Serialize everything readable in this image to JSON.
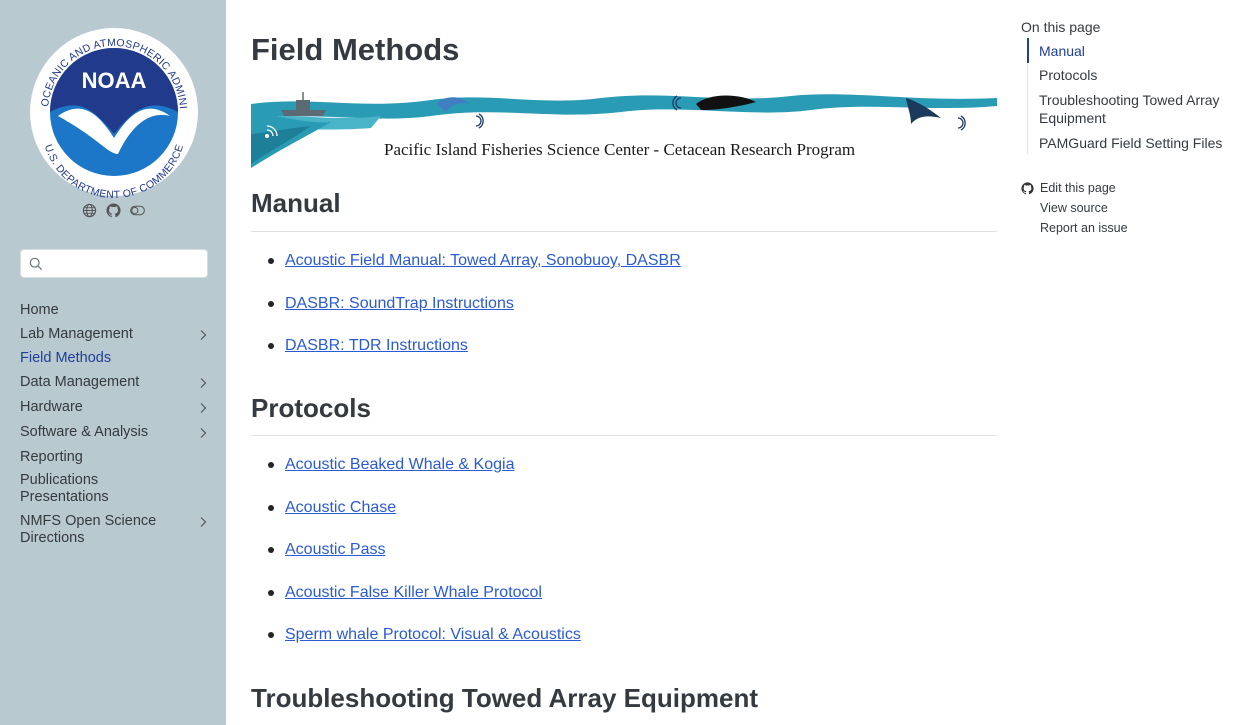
{
  "logo": {
    "agency_name": "NATIONAL OCEANIC AND ATMOSPHERIC ADMINISTRATION",
    "department": "U.S. DEPARTMENT OF COMMERCE",
    "acronym": "NOAA",
    "colors": {
      "dark_blue": "#223a8c",
      "light_blue": "#1d77c8"
    }
  },
  "sidebar": {
    "tools": [
      "globe-icon",
      "github-icon",
      "toggle-icon"
    ],
    "search": {
      "placeholder": "",
      "value": ""
    },
    "items": [
      {
        "label": "Home",
        "has_children": false,
        "active": false
      },
      {
        "label": "Lab Management",
        "has_children": true,
        "active": false
      },
      {
        "label": "Field Methods",
        "has_children": false,
        "active": true
      },
      {
        "label": "Data Management",
        "has_children": true,
        "active": false
      },
      {
        "label": "Hardware",
        "has_children": true,
        "active": false
      },
      {
        "label": "Software & Analysis",
        "has_children": true,
        "active": false
      },
      {
        "label": "Reporting",
        "has_children": false,
        "active": false
      },
      {
        "label": "Publications Presentations",
        "has_children": false,
        "active": false
      },
      {
        "label": "NMFS Open Science Directions",
        "has_children": true,
        "active": false
      }
    ]
  },
  "main": {
    "title": "Field Methods",
    "banner_text": "Pacific Island Fisheries Science Center - Cetacean Research Program",
    "sections": [
      {
        "heading": "Manual",
        "links": [
          "Acoustic Field Manual: Towed Array, Sonobuoy, DASBR",
          "DASBR: SoundTrap Instructions",
          "DASBR: TDR Instructions"
        ]
      },
      {
        "heading": "Protocols",
        "links": [
          "Acoustic Beaked Whale & Kogia",
          "Acoustic Chase",
          "Acoustic Pass",
          "Acoustic False Killer Whale Protocol",
          "Sperm whale Protocol: Visual & Acoustics"
        ]
      },
      {
        "heading": "Troubleshooting Towed Array Equipment",
        "links": []
      }
    ]
  },
  "toc": {
    "title": "On this page",
    "items": [
      {
        "label": "Manual",
        "active": true
      },
      {
        "label": "Protocols",
        "active": false
      },
      {
        "label": "Troubleshooting Towed Array Equipment",
        "active": false
      },
      {
        "label": "PAMGuard Field Setting Files",
        "active": false
      }
    ],
    "actions": [
      "Edit this page",
      "View source",
      "Report an issue"
    ]
  },
  "colors": {
    "sidebar_bg": "#b9c9d0",
    "link": "#2a5ad4",
    "active": "#1f3f99",
    "banner_teal": "#2a9bb5"
  }
}
